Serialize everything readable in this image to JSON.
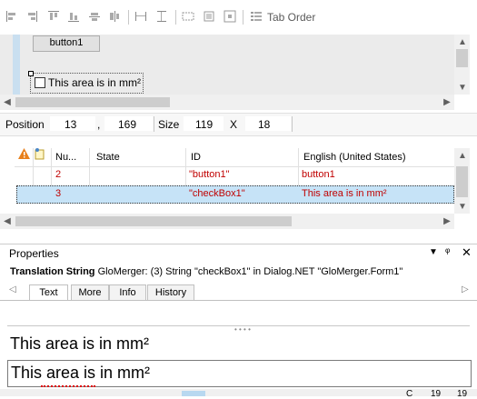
{
  "toolbar": {
    "icons": [
      "align-left-icon",
      "align-right-icon",
      "align-top-icon",
      "align-bottom-icon",
      "center-vertical-icon",
      "center-horizontal-icon",
      "same-width-icon",
      "same-height-icon",
      "make-same-size-icon",
      "size-to-grid-icon",
      "grid-icon",
      "tab-order-icon"
    ],
    "tab_order_label": "Tab Order"
  },
  "design": {
    "button_label": "button1",
    "checkbox_label": "This area is in mm²"
  },
  "position_bar": {
    "position_label": "Position",
    "x": "13",
    "comma": ",",
    "y": "169",
    "size_label": "Size",
    "width": "119",
    "x_sep": "X",
    "height": "18"
  },
  "grid": {
    "columns": [
      "Nu...",
      "State",
      "ID",
      "English (United States)"
    ],
    "rows": [
      {
        "num": "2",
        "state": "",
        "id": "\"button1\"",
        "english": "button1",
        "selected": false
      },
      {
        "num": "3",
        "state": "",
        "id": "\"checkBox1\"",
        "english": "This area is in mm²",
        "selected": true
      }
    ]
  },
  "properties": {
    "title": "Properties",
    "translation_label": "Translation String",
    "translation_value": "GloMerger: (3) String \"checkBox1\" in Dialog.NET \"GloMerger.Form1\"",
    "tabs": [
      "Text",
      "More",
      "Info",
      "History"
    ],
    "source_text": "This area is in mm²",
    "translation_text": "This area is in mm²"
  },
  "status": {
    "c": "C",
    "a": "19",
    "b": "19"
  }
}
